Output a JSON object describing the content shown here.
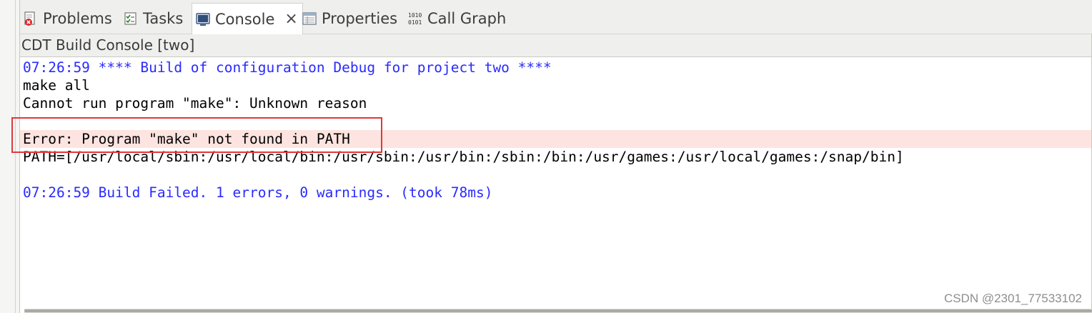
{
  "tabs": [
    {
      "label": "Problems",
      "icon": "problems-icon",
      "active": false
    },
    {
      "label": "Tasks",
      "icon": "tasks-icon",
      "active": false
    },
    {
      "label": "Console",
      "icon": "console-icon",
      "active": true,
      "close": "×"
    },
    {
      "label": "Properties",
      "icon": "properties-icon",
      "active": false
    },
    {
      "label": "Call Graph",
      "icon": "call-graph-icon",
      "active": false
    }
  ],
  "console_title": "CDT Build Console [two]",
  "console_lines": [
    {
      "text": "07:26:59 **** Build of configuration Debug for project two ****",
      "kind": "info"
    },
    {
      "text": "make all",
      "kind": "plain"
    },
    {
      "text": "Cannot run program \"make\": Unknown reason",
      "kind": "plain"
    },
    {
      "text": "",
      "kind": "plain"
    },
    {
      "text": "Error: Program \"make\" not found in PATH",
      "kind": "error"
    },
    {
      "text": "PATH=[/usr/local/sbin:/usr/local/bin:/usr/sbin:/usr/bin:/sbin:/bin:/usr/games:/usr/local/games:/snap/bin]",
      "kind": "plain"
    },
    {
      "text": "",
      "kind": "plain"
    },
    {
      "text": "07:26:59 Build Failed. 1 errors, 0 warnings. (took 78ms)",
      "kind": "info"
    }
  ],
  "watermark": "CSDN @2301_77533102",
  "colors": {
    "info_text": "#2a2aff",
    "error_line_bg": "#fde4e0",
    "annotation_box": "#e0383b"
  }
}
